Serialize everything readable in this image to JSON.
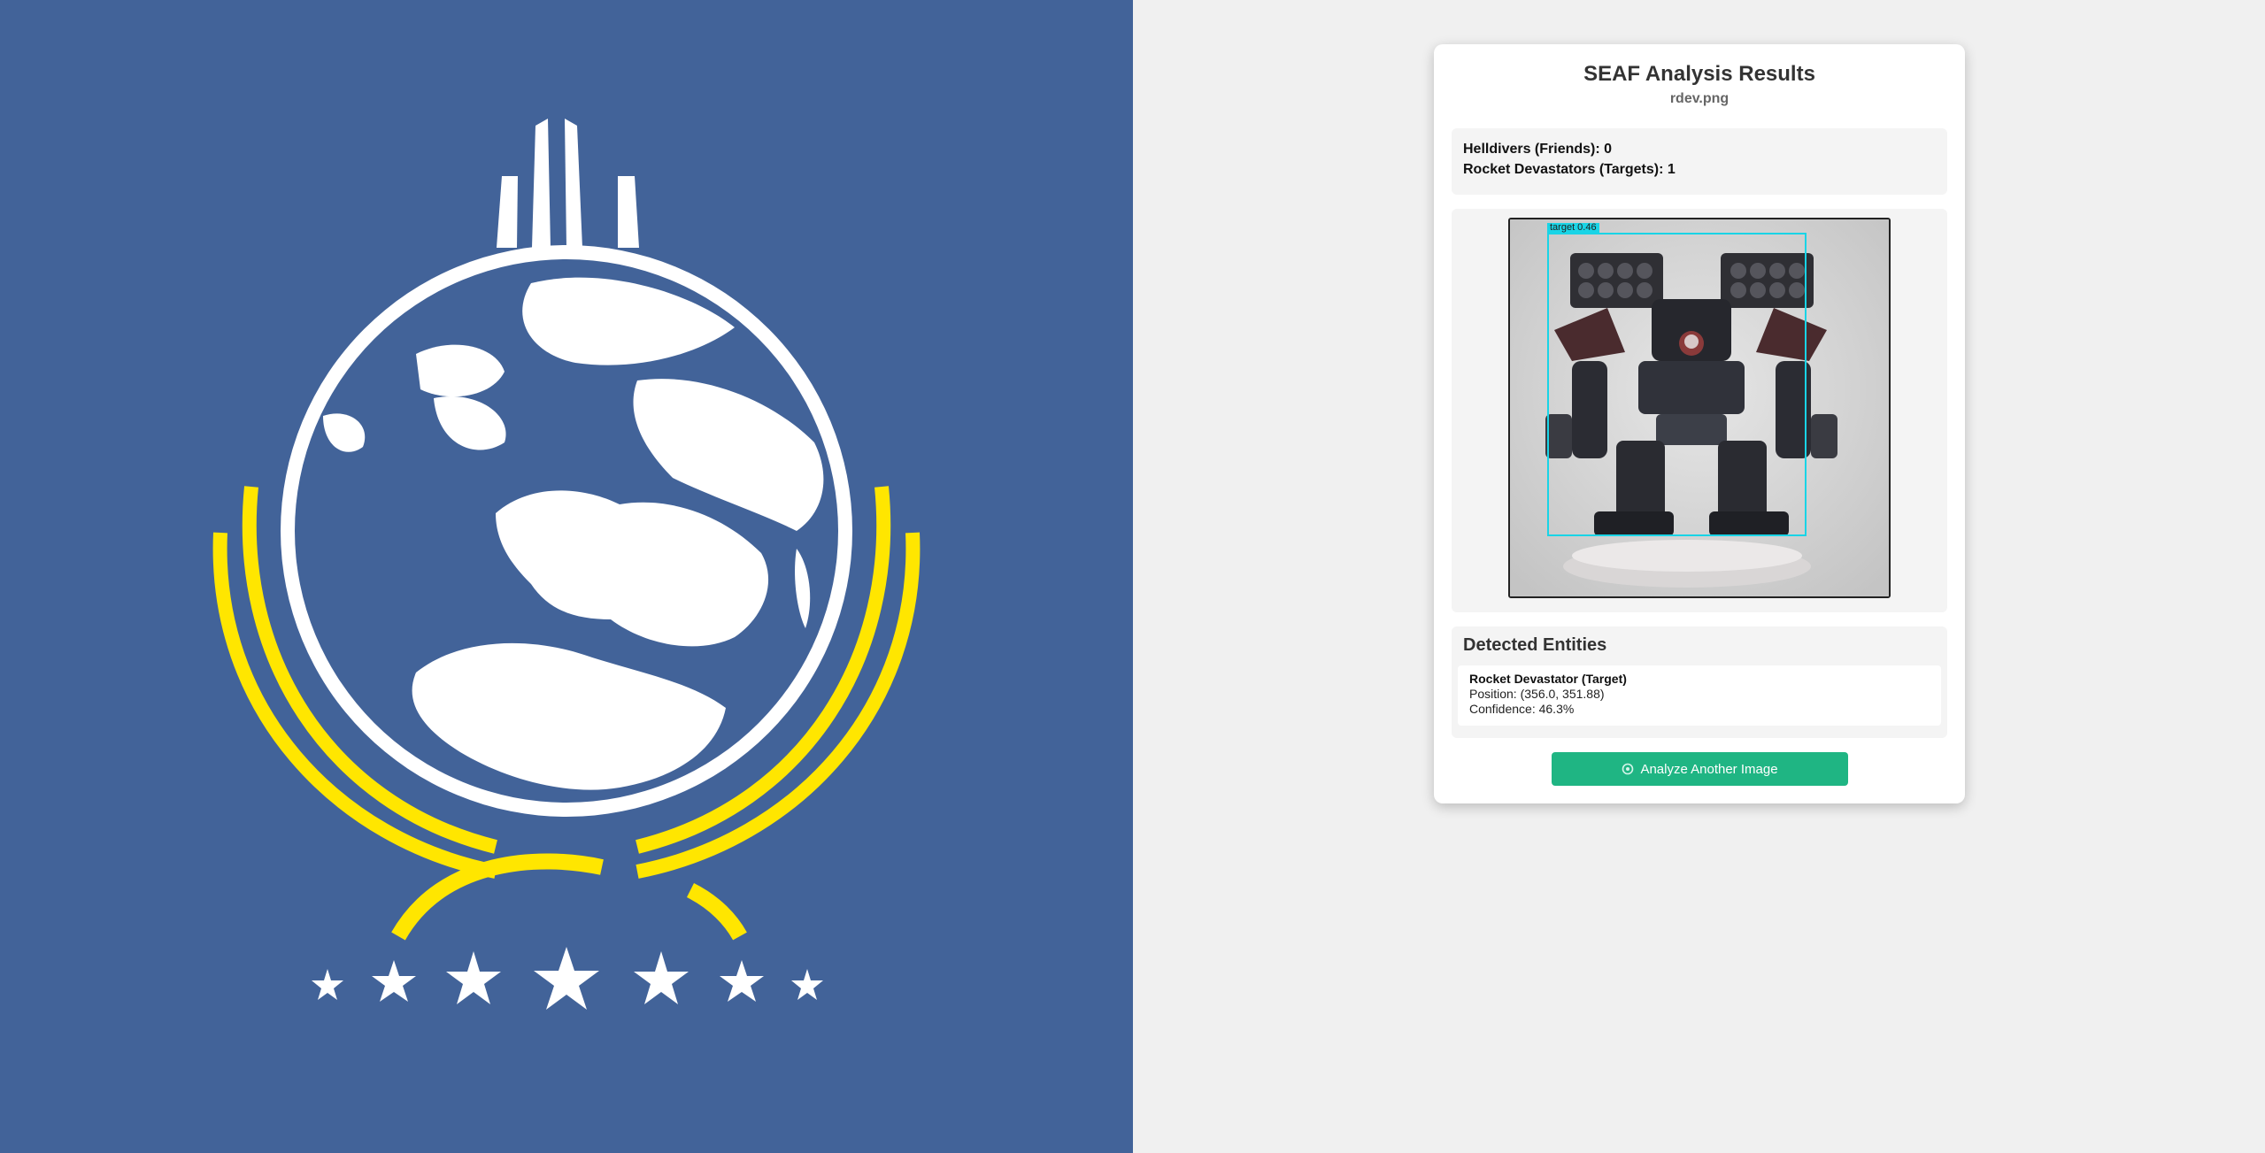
{
  "emblem": {
    "background_color": "#426399",
    "gold_color": "#ffe600",
    "white_color": "#ffffff",
    "icon": "seaf-globe-emblem"
  },
  "results": {
    "title": "SEAF Analysis Results",
    "filename": "rdev.png",
    "summary": {
      "friends_line": "Helldivers (Friends): 0",
      "targets_line": "Rocket Devastators (Targets): 1"
    },
    "detection_image": {
      "box_label": "target 0.46",
      "box_color": "#19d4e6"
    },
    "entities": {
      "heading": "Detected Entities",
      "items": [
        {
          "name": "Rocket Devastator (Target)",
          "position": "Position: (356.0, 351.88)",
          "confidence": "Confidence: 46.3%"
        }
      ]
    },
    "analyze_button": {
      "label": "Analyze Another Image",
      "icon": "analyze-icon",
      "color": "#1fb583"
    }
  }
}
